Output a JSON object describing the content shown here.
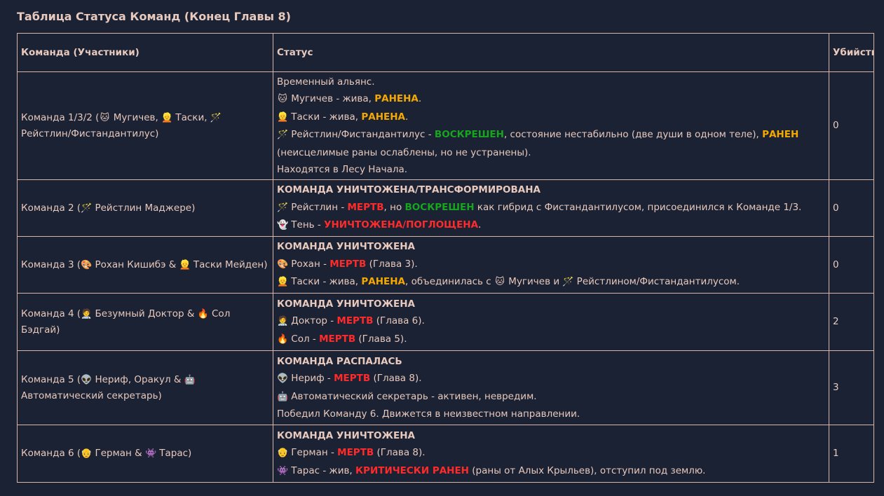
{
  "title": "Таблица Статуса Команд (Конец Главы 8)",
  "headers": {
    "team": "Команда (Участники)",
    "status": "Статус",
    "kills": "Убийства"
  },
  "rows": [
    {
      "team_parts": [
        "Команда 1/3/2 (",
        "🐱",
        " Мугичев, ",
        "👱",
        " Таски, ",
        "🪄",
        " Рейстлин/Фистандантилус)"
      ],
      "status_lines": [
        [
          {
            "t": "Временный альянс.",
            "c": "plain"
          }
        ],
        [
          {
            "t": "🐱",
            "c": "ico"
          },
          {
            "t": " Мугичев - жива, ",
            "c": "plain"
          },
          {
            "t": "РАНЕНА",
            "c": "wounded"
          },
          {
            "t": ".",
            "c": "plain"
          }
        ],
        [
          {
            "t": "👱",
            "c": "ico"
          },
          {
            "t": " Таски - жива, ",
            "c": "plain"
          },
          {
            "t": "РАНЕНА",
            "c": "wounded"
          },
          {
            "t": ".",
            "c": "plain"
          }
        ],
        [
          {
            "t": "🪄",
            "c": "ico"
          },
          {
            "t": " Рейстлин/Фистандантилус - ",
            "c": "plain"
          },
          {
            "t": "ВОСКРЕШЕН",
            "c": "revived"
          },
          {
            "t": ", состояние нестабильно (две души в одном теле), ",
            "c": "plain"
          },
          {
            "t": "РАНЕН",
            "c": "wounded"
          }
        ],
        [
          {
            "t": "(неисцелимые раны ослаблены, но не устранены).",
            "c": "plain"
          }
        ],
        [
          {
            "t": "Находятся в Лесу Начала.",
            "c": "plain"
          }
        ]
      ],
      "kills": "0"
    },
    {
      "team_parts": [
        "Команда 2 (",
        "🪄",
        " Рейстлин Маджере)"
      ],
      "status_lines": [
        [
          {
            "t": "КОМАНДА УНИЧТОЖЕНА/ТРАНСФОРМИРОВАНА",
            "c": "b"
          }
        ],
        [
          {
            "t": "🪄",
            "c": "ico"
          },
          {
            "t": " Рейстлин - ",
            "c": "plain"
          },
          {
            "t": "МЕРТВ",
            "c": "dead"
          },
          {
            "t": ", но ",
            "c": "plain"
          },
          {
            "t": "ВОСКРЕШЕН",
            "c": "revived"
          },
          {
            "t": " как гибрид с Фистандантилусом, присоединился к Команде 1/3.",
            "c": "plain"
          }
        ],
        [
          {
            "t": "👻",
            "c": "ico"
          },
          {
            "t": " Тень - ",
            "c": "plain"
          },
          {
            "t": "УНИЧТОЖЕНА/ПОГЛОЩЕНА",
            "c": "dead"
          },
          {
            "t": ".",
            "c": "plain"
          }
        ]
      ],
      "kills": "0"
    },
    {
      "team_parts": [
        "Команда 3 (",
        "🎨",
        " Рохан Кишибэ & ",
        "👱",
        " Таски Мейден)"
      ],
      "status_lines": [
        [
          {
            "t": "КОМАНДА УНИЧТОЖЕНА",
            "c": "b"
          }
        ],
        [
          {
            "t": "🎨",
            "c": "ico"
          },
          {
            "t": " Рохан - ",
            "c": "plain"
          },
          {
            "t": "МЕРТВ",
            "c": "dead"
          },
          {
            "t": " (Глава 3).",
            "c": "plain"
          }
        ],
        [
          {
            "t": "👱",
            "c": "ico"
          },
          {
            "t": " Таски - жива, ",
            "c": "plain"
          },
          {
            "t": "РАНЕНА",
            "c": "wounded"
          },
          {
            "t": ", объединилась с ",
            "c": "plain"
          },
          {
            "t": "🐱",
            "c": "ico"
          },
          {
            "t": " Мугичев и ",
            "c": "plain"
          },
          {
            "t": "🪄",
            "c": "ico"
          },
          {
            "t": " Рейстлином/Фистандантилусом.",
            "c": "plain"
          }
        ]
      ],
      "kills": "0"
    },
    {
      "team_parts": [
        "Команда 4 (",
        "🧑‍⚕️",
        " Безумный Доктор & ",
        "🔥",
        " Сол Бэдгай)"
      ],
      "status_lines": [
        [
          {
            "t": "КОМАНДА УНИЧТОЖЕНА",
            "c": "b"
          }
        ],
        [
          {
            "t": "🧑‍⚕️",
            "c": "ico"
          },
          {
            "t": " Доктор - ",
            "c": "plain"
          },
          {
            "t": "МЕРТВ",
            "c": "dead"
          },
          {
            "t": " (Глава 6).",
            "c": "plain"
          }
        ],
        [
          {
            "t": "🔥",
            "c": "ico"
          },
          {
            "t": " Сол - ",
            "c": "plain"
          },
          {
            "t": "МЕРТВ",
            "c": "dead"
          },
          {
            "t": " (Глава 5).",
            "c": "plain"
          }
        ]
      ],
      "kills": "2"
    },
    {
      "team_parts": [
        "Команда 5 (",
        "👽",
        " Нериф, Оракул & ",
        "🤖",
        " Автоматический секретарь)"
      ],
      "status_lines": [
        [
          {
            "t": "КОМАНДА РАСПАЛАСЬ",
            "c": "b"
          }
        ],
        [
          {
            "t": "👽",
            "c": "ico"
          },
          {
            "t": " Нериф - ",
            "c": "plain"
          },
          {
            "t": "МЕРТВ",
            "c": "dead"
          },
          {
            "t": " (Глава 8).",
            "c": "plain"
          }
        ],
        [
          {
            "t": "🤖",
            "c": "ico"
          },
          {
            "t": " Автоматический секретарь - активен, невредим.",
            "c": "plain"
          }
        ],
        [
          {
            "t": "Победил Команду 6. Движется в неизвестном направлении.",
            "c": "plain"
          }
        ]
      ],
      "kills": "3"
    },
    {
      "team_parts": [
        "Команда 6 (",
        "👴",
        " Герман & ",
        "👾",
        " Тарас)"
      ],
      "status_lines": [
        [
          {
            "t": "КОМАНДА УНИЧТОЖЕНА",
            "c": "b"
          }
        ],
        [
          {
            "t": "👴",
            "c": "ico"
          },
          {
            "t": " Герман - ",
            "c": "plain"
          },
          {
            "t": "МЕРТВ",
            "c": "dead"
          },
          {
            "t": " (Глава 8).",
            "c": "plain"
          }
        ],
        [
          {
            "t": "👾",
            "c": "ico"
          },
          {
            "t": " Тарас - жив, ",
            "c": "plain"
          },
          {
            "t": "КРИТИЧЕСКИ РАНЕН",
            "c": "dead"
          },
          {
            "t": " (раны от Алых Крыльев), отступил под землю.",
            "c": "plain"
          }
        ]
      ],
      "kills": "1"
    }
  ]
}
